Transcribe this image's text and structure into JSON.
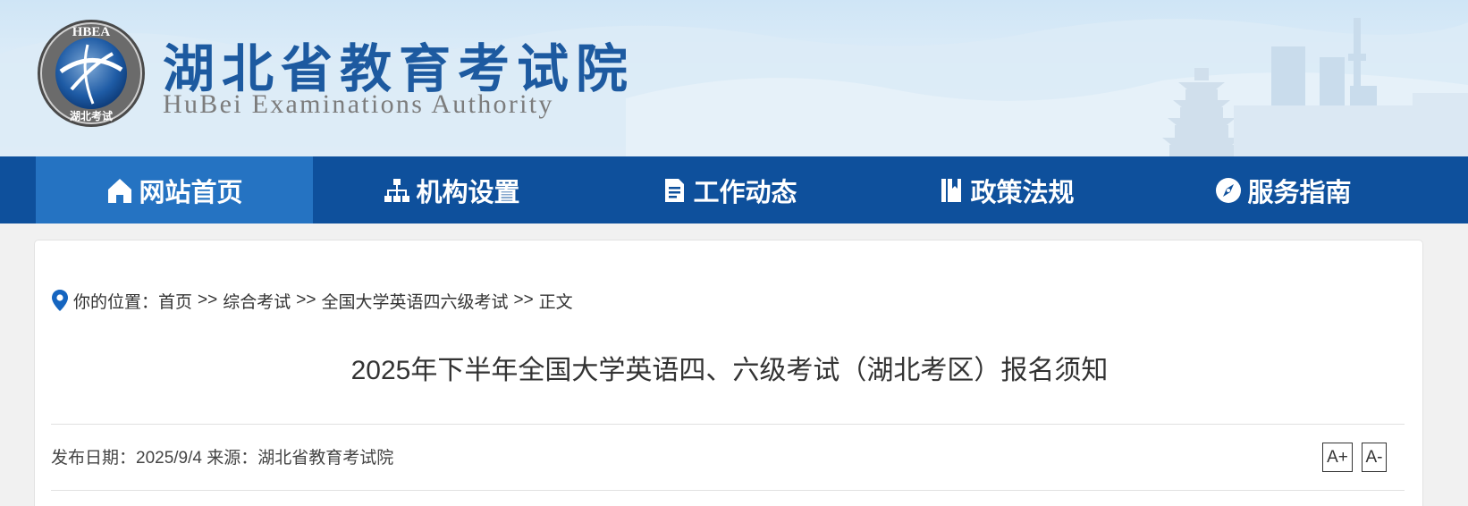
{
  "header": {
    "logo_text": "HBEA",
    "logo_caption": "湖北考试",
    "title": "湖北省教育考试院",
    "subtitle": "HuBei Examinations Authority"
  },
  "nav": {
    "items": [
      {
        "label": "网站首页",
        "icon": "home-icon",
        "active": true
      },
      {
        "label": "机构设置",
        "icon": "org-chart-icon",
        "active": false
      },
      {
        "label": "工作动态",
        "icon": "document-icon",
        "active": false
      },
      {
        "label": "政策法规",
        "icon": "book-icon",
        "active": false
      },
      {
        "label": "服务指南",
        "icon": "compass-icon",
        "active": false
      }
    ]
  },
  "breadcrumb": {
    "prefix": "你的位置：",
    "separator": ">>",
    "items": [
      "首页",
      "综合考试",
      "全国大学英语四六级考试",
      "正文"
    ]
  },
  "article": {
    "title": "2025年下半年全国大学英语四、六级考试（湖北考区）报名须知",
    "date_label": "发布日期：",
    "date": "2025/9/4",
    "source_label": "来源：",
    "source": "湖北省教育考试院",
    "font_increase": "A+",
    "font_decrease": "A-"
  },
  "colors": {
    "nav_bg": "#0e509c",
    "nav_active": "#2573c2",
    "title_blue": "#1d5aa0",
    "location_pin": "#1565c0"
  }
}
